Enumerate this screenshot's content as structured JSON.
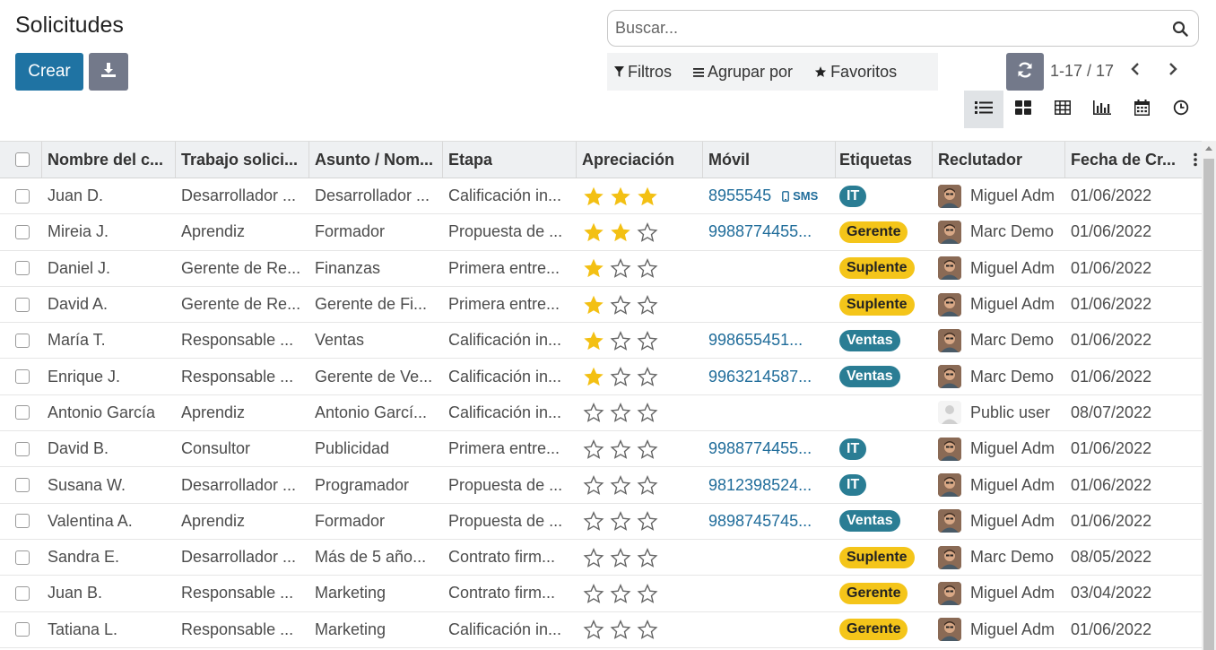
{
  "page": {
    "title": "Solicitudes"
  },
  "toolbar": {
    "create_label": "Crear",
    "download_icon": "download-icon"
  },
  "search": {
    "placeholder": "Buscar..."
  },
  "filters": {
    "filters_label": "Filtros",
    "group_by_label": "Agrupar por",
    "favorites_label": "Favoritos"
  },
  "pager": {
    "value": "1-17 / 17"
  },
  "views": [
    "list-view-icon",
    "kanban-view-icon",
    "pivot-view-icon",
    "graph-view-icon",
    "calendar-view-icon",
    "activity-view-icon"
  ],
  "colors": {
    "primary": "#1f73a3",
    "secondary": "#73798a",
    "tag_teal": "#2a7d94",
    "tag_yellow": "#f4c51a",
    "star": "#f3c013",
    "link": "#1f6c9a"
  },
  "table": {
    "headers": {
      "name": "Nombre del c...",
      "job": "Trabajo solici...",
      "subject": "Asunto / Nom...",
      "stage": "Etapa",
      "appreciation": "Apreciación",
      "mobile": "Móvil",
      "tags": "Etiquetas",
      "recruiter": "Reclutador",
      "date": "Fecha de Cr..."
    },
    "sms_label": "SMS",
    "rows": [
      {
        "name": "Juan D.",
        "job": "Desarrollador ...",
        "subject": "Desarrollador ...",
        "stage": "Calificación in...",
        "stars": 3,
        "mobile": "8955545",
        "sms": true,
        "tag": "IT",
        "tag_color": "teal",
        "recruiter": "Miguel Adm",
        "avatar": "photo",
        "date": "01/06/2022"
      },
      {
        "name": "Mireia J.",
        "job": "Aprendiz",
        "subject": "Formador",
        "stage": "Propuesta de ...",
        "stars": 2,
        "mobile": "9988774455...",
        "sms": false,
        "tag": "Gerente",
        "tag_color": "yellow",
        "recruiter": "Marc Demo",
        "avatar": "photo",
        "date": "01/06/2022"
      },
      {
        "name": "Daniel J.",
        "job": "Gerente de Re...",
        "subject": "Finanzas",
        "stage": "Primera entre...",
        "stars": 1,
        "mobile": "",
        "sms": false,
        "tag": "Suplente",
        "tag_color": "yellow",
        "recruiter": "Miguel Adm",
        "avatar": "photo",
        "date": "01/06/2022"
      },
      {
        "name": "David A.",
        "job": "Gerente de Re...",
        "subject": "Gerente de Fi...",
        "stage": "Primera entre...",
        "stars": 1,
        "mobile": "",
        "sms": false,
        "tag": "Suplente",
        "tag_color": "yellow",
        "recruiter": "Miguel Adm",
        "avatar": "photo",
        "date": "01/06/2022"
      },
      {
        "name": "María T.",
        "job": "Responsable ...",
        "subject": "Ventas",
        "stage": "Calificación in...",
        "stars": 1,
        "mobile": "998655451...",
        "sms": false,
        "tag": "Ventas",
        "tag_color": "teal",
        "recruiter": "Marc Demo",
        "avatar": "photo",
        "date": "01/06/2022"
      },
      {
        "name": "Enrique J.",
        "job": "Responsable ...",
        "subject": "Gerente de Ve...",
        "stage": "Calificación in...",
        "stars": 1,
        "mobile": "9963214587...",
        "sms": false,
        "tag": "Ventas",
        "tag_color": "teal",
        "recruiter": "Marc Demo",
        "avatar": "photo",
        "date": "01/06/2022"
      },
      {
        "name": "Antonio García",
        "job": "Aprendiz",
        "subject": "Antonio Garcí...",
        "stage": "Calificación in...",
        "stars": 0,
        "mobile": "",
        "sms": false,
        "tag": "",
        "tag_color": "",
        "recruiter": "Public user",
        "avatar": "public",
        "date": "08/07/2022"
      },
      {
        "name": "David B.",
        "job": "Consultor",
        "subject": "Publicidad",
        "stage": "Primera entre...",
        "stars": 0,
        "mobile": "9988774455...",
        "sms": false,
        "tag": "IT",
        "tag_color": "teal",
        "recruiter": "Miguel Adm",
        "avatar": "photo",
        "date": "01/06/2022"
      },
      {
        "name": "Susana W.",
        "job": "Desarrollador ...",
        "subject": "Programador",
        "stage": "Propuesta de ...",
        "stars": 0,
        "mobile": "9812398524...",
        "sms": false,
        "tag": "IT",
        "tag_color": "teal",
        "recruiter": "Miguel Adm",
        "avatar": "photo",
        "date": "01/06/2022"
      },
      {
        "name": "Valentina A.",
        "job": "Aprendiz",
        "subject": "Formador",
        "stage": "Propuesta de ...",
        "stars": 0,
        "mobile": "9898745745...",
        "sms": false,
        "tag": "Ventas",
        "tag_color": "teal",
        "recruiter": "Miguel Adm",
        "avatar": "photo",
        "date": "01/06/2022"
      },
      {
        "name": "Sandra E.",
        "job": "Desarrollador ...",
        "subject": "Más de 5 año...",
        "stage": "Contrato firm...",
        "stars": 0,
        "mobile": "",
        "sms": false,
        "tag": "Suplente",
        "tag_color": "yellow",
        "recruiter": "Marc Demo",
        "avatar": "photo",
        "date": "08/05/2022"
      },
      {
        "name": "Juan B.",
        "job": "Responsable ...",
        "subject": "Marketing",
        "stage": "Contrato firm...",
        "stars": 0,
        "mobile": "",
        "sms": false,
        "tag": "Gerente",
        "tag_color": "yellow",
        "recruiter": "Miguel Adm",
        "avatar": "photo",
        "date": "03/04/2022"
      },
      {
        "name": "Tatiana L.",
        "job": "Responsable ...",
        "subject": "Marketing",
        "stage": "Calificación in...",
        "stars": 0,
        "mobile": "",
        "sms": false,
        "tag": "Gerente",
        "tag_color": "yellow",
        "recruiter": "Miguel Adm",
        "avatar": "photo",
        "date": "01/06/2022"
      }
    ]
  }
}
